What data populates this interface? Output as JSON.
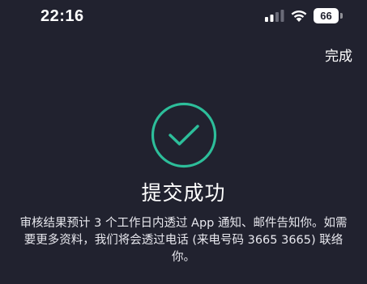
{
  "status_bar": {
    "time": "22:16",
    "battery_level": "66",
    "icons": [
      "signal-icon",
      "wifi-icon",
      "battery-icon"
    ]
  },
  "header": {
    "done_label": "完成"
  },
  "main": {
    "icon": "check-circle-icon",
    "title": "提交成功",
    "message": "审核结果预计 3 个工作日内透过 App 通知、邮件告知你。如需要更多资料，我们将会透过电话 (来电号码 3665 3665) 联络你。"
  },
  "colors": {
    "background": "#21222f",
    "accent": "#2dbe9a",
    "text": "#ffffff"
  }
}
